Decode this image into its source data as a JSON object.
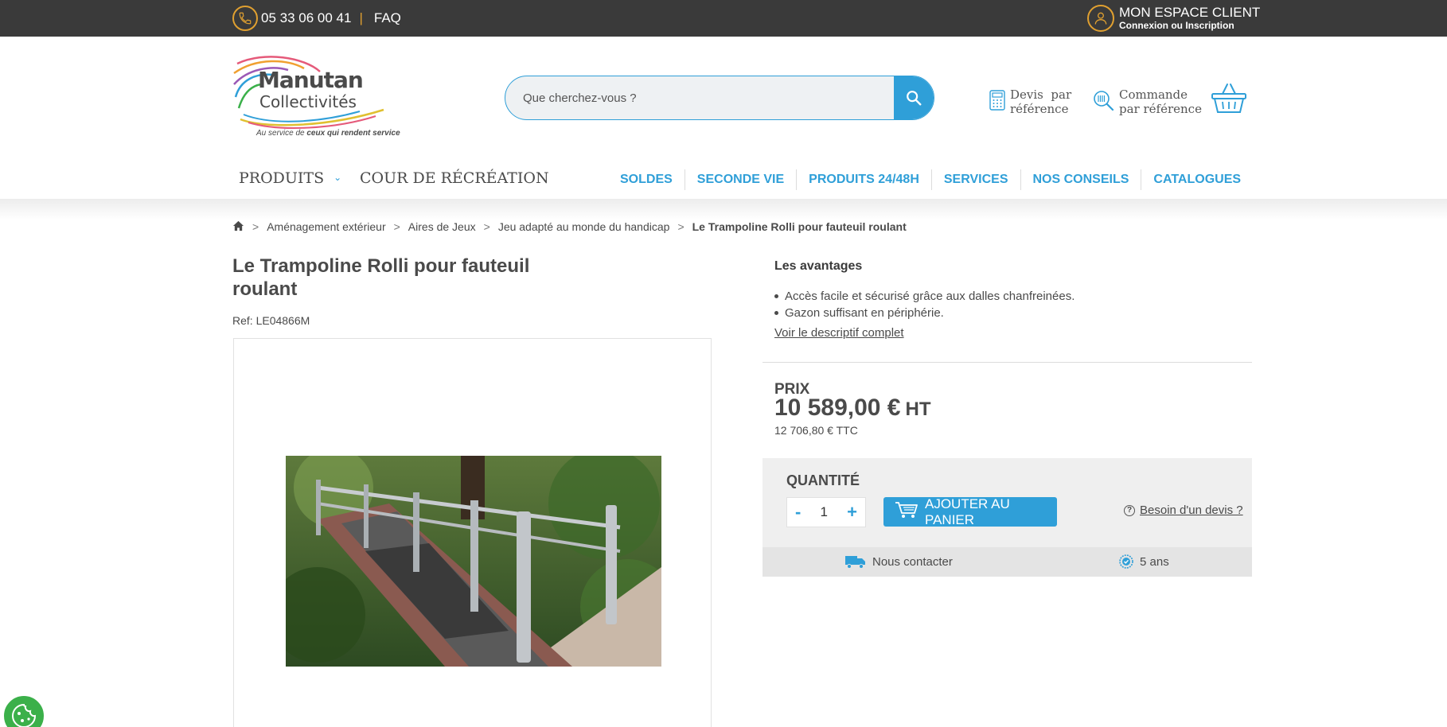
{
  "topbar": {
    "phone": "05 33 06 00 41",
    "separator": "|",
    "faq": "FAQ",
    "account_title": "MON ESPACE CLIENT",
    "account_subtitle": "Connexion ou Inscription"
  },
  "logo": {
    "line1": "Manutan",
    "line2": "Collectivités",
    "tagline_prefix": "Au service de",
    "tagline_bold": "ceux qui rendent service"
  },
  "search": {
    "placeholder": "Que cherchez-vous ?"
  },
  "header_links": {
    "devis_line1": "Devis  par",
    "devis_line2": "référence",
    "commande_line1": "Commande",
    "commande_line2": "par référence"
  },
  "nav": {
    "produits": "PRODUITS",
    "cour": "COUR DE RÉCRÉATION",
    "right": [
      "SOLDES",
      "SECONDE VIE",
      "PRODUITS 24/48H",
      "SERVICES",
      "NOS CONSEILS",
      "CATALOGUES"
    ]
  },
  "breadcrumb": {
    "items": [
      "Aménagement extérieur",
      "Aires de Jeux",
      "Jeu adapté au monde du handicap"
    ],
    "current": "Le Trampoline Rolli pour fauteuil roulant",
    "sep": ">"
  },
  "product": {
    "title_line1": "Le Trampoline Rolli pour fauteuil",
    "title_line2": "roulant",
    "ref": "Ref: LE04866M"
  },
  "advantages": {
    "title": "Les avantages",
    "items": [
      "Accès facile et sécurisé grâce aux dalles chanfreinées.",
      "Gazon suffisant en périphérie."
    ],
    "more": "Voir le descriptif complet"
  },
  "price": {
    "label": "PRIX",
    "value": "10 589,00 €",
    "ht": "HT",
    "ttc": "12 706,80 € TTC"
  },
  "quantity": {
    "label": "QUANTITÉ",
    "minus": "-",
    "value": "1",
    "plus": "+",
    "add_to_cart": "AJOUTER AU PANIER",
    "devis": "Besoin d'un devis ?"
  },
  "info": {
    "delivery": "Nous contacter",
    "warranty": "5 ans"
  },
  "colors": {
    "accent": "#2f9fd8",
    "topbar": "#3a3a3a",
    "gold": "#e0a030",
    "cookie": "#3bb04a"
  }
}
